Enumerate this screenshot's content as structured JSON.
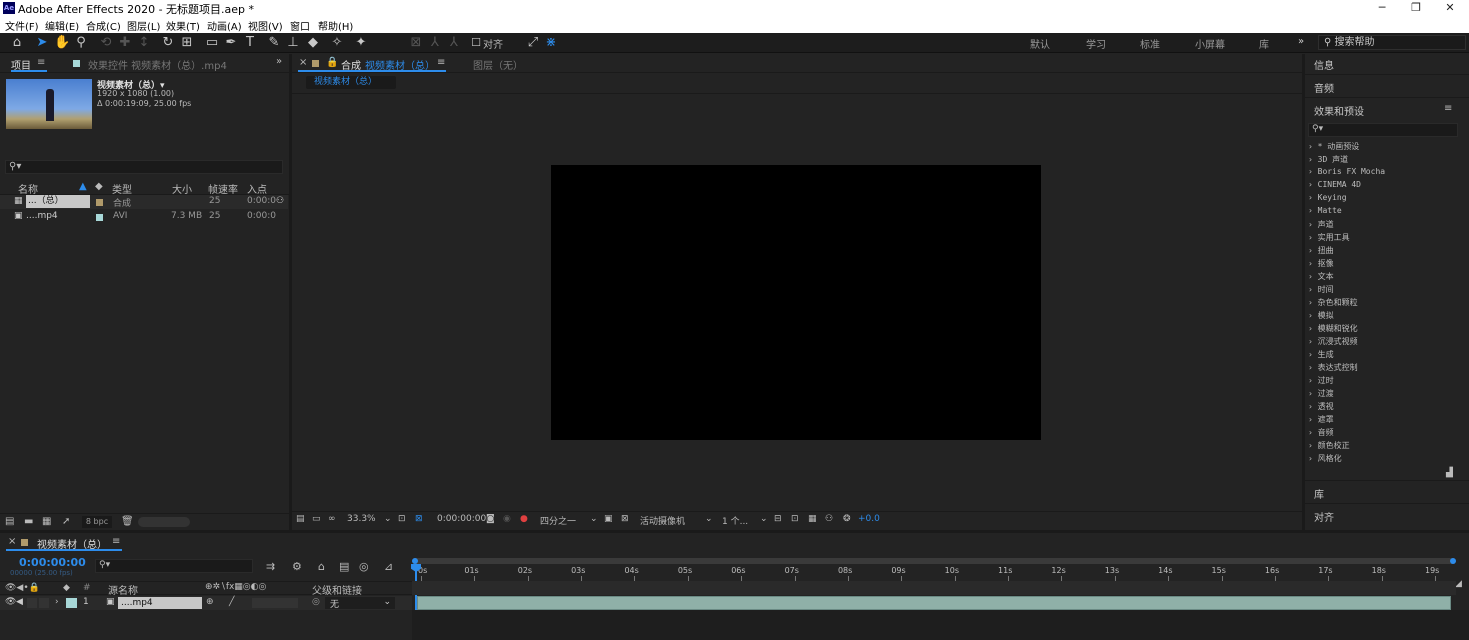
{
  "app": {
    "title": "Adobe After Effects 2020 - 无标题项目.aep *",
    "logo": "Ae",
    "window_buttons": [
      "─",
      "❐",
      "✕"
    ]
  },
  "menu": [
    "文件(F)",
    "编辑(E)",
    "合成(C)",
    "图层(L)",
    "效果(T)",
    "动画(A)",
    "视图(V)",
    "窗口",
    "帮助(H)"
  ],
  "toolbar": {
    "align_label": "对齐",
    "workspaces": [
      "默认",
      "学习",
      "标准",
      "小屏幕",
      "库"
    ],
    "search_help_placeholder": "搜索帮助"
  },
  "project": {
    "tab_project": "项目",
    "tab_effects": "效果控件 视频素材（总）.mp4",
    "item_name": "视频素材（总）▾",
    "item_dims": "1920 x 1080 (1.00)",
    "item_duration": "Δ 0:00:19:09, 25.00 fps",
    "columns": {
      "name": "名称",
      "type": "类型",
      "size": "大小",
      "fps": "帧速率",
      "in": "入点"
    },
    "rows": [
      {
        "name": "...（总）",
        "type": "合成",
        "size": "",
        "fps": "25",
        "in": "0:00:0",
        "color": "#b09a6a"
      },
      {
        "name": "....mp4",
        "type": "AVI",
        "size": "7.3 MB",
        "fps": "25",
        "in": "0:00:0",
        "color": "#a8d8d8"
      }
    ],
    "bpc": "8 bpc"
  },
  "viewer": {
    "tab_comp_prefix": "合成",
    "tab_comp_name": "视频素材（总）",
    "tab_layer": "图层（无）",
    "breadcrumb": "视频素材（总）",
    "zoom": "33.3%",
    "timecode": "0:00:00:00",
    "resolution": "四分之一",
    "camera": "活动摄像机",
    "views": "1 个...",
    "exposure": "+0.0"
  },
  "right_panel": {
    "info": "信息",
    "audio": "音频",
    "effects_presets": "效果和预设",
    "library": "库",
    "align": "对齐",
    "fx_categories": [
      "* 动画预设",
      "3D 声道",
      "Boris FX Mocha",
      "CINEMA 4D",
      "Keying",
      "Matte",
      "声道",
      "实用工具",
      "扭曲",
      "抠像",
      "文本",
      "时间",
      "杂色和颗粒",
      "模拟",
      "模糊和锐化",
      "沉浸式视频",
      "生成",
      "表达式控制",
      "过时",
      "过渡",
      "透视",
      "遮罩",
      "音频",
      "颜色校正",
      "风格化"
    ]
  },
  "timeline": {
    "tab": "视频素材（总）",
    "timecode": "0:00:00:00",
    "frames": "00000 (25.00 fps)",
    "col_source": "源名称",
    "col_parent": "父级和链接",
    "ticks": [
      "0s",
      "01s",
      "02s",
      "03s",
      "04s",
      "05s",
      "06s",
      "07s",
      "08s",
      "09s",
      "10s",
      "11s",
      "12s",
      "13s",
      "14s",
      "15s",
      "16s",
      "17s",
      "18s",
      "19s"
    ],
    "layer": {
      "index": "1",
      "name": "....mp4",
      "parent": "无",
      "color": "#a8d8d8"
    }
  }
}
